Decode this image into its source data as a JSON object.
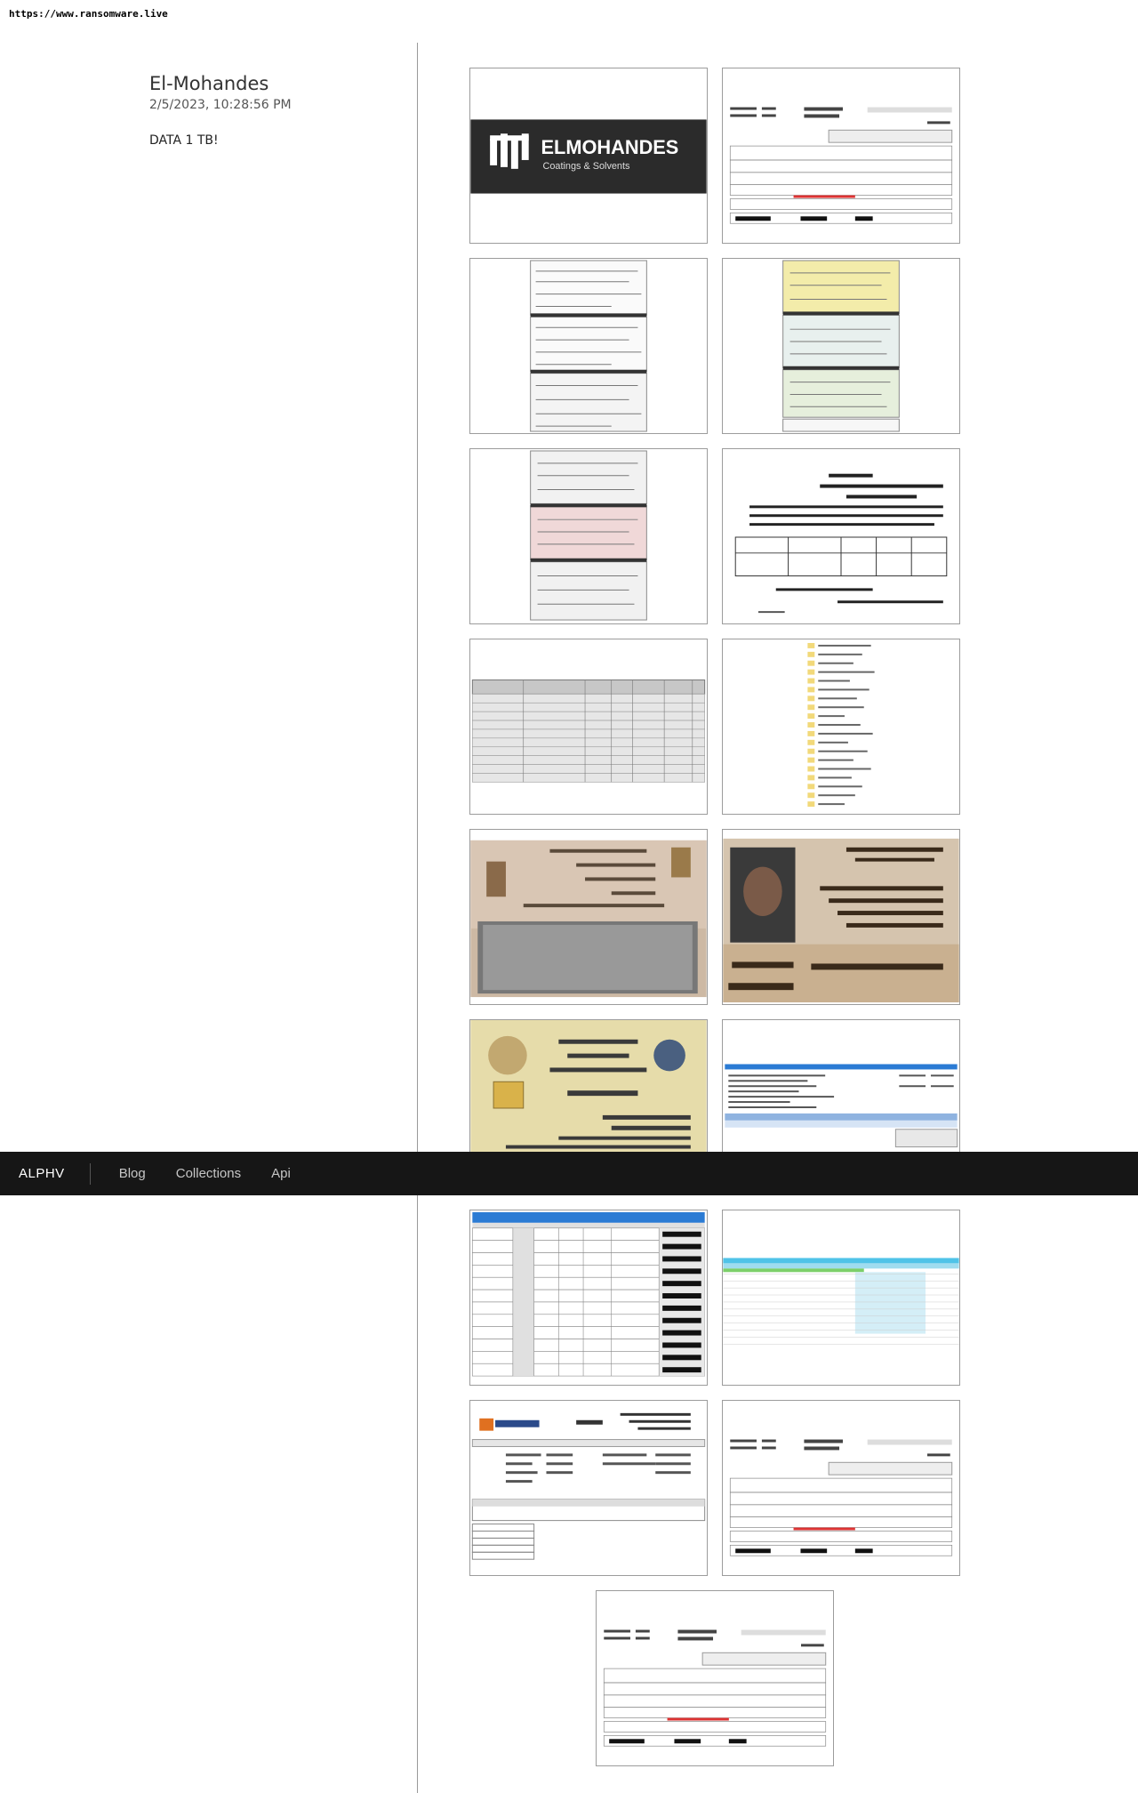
{
  "browser": {
    "url": "https://www.ransomware.live"
  },
  "post": {
    "title": "El-Mohandes",
    "date": "2/5/2023, 10:28:56 PM",
    "description": "DATA 1 TB!"
  },
  "navbar": {
    "brand": "ALPHV",
    "links": [
      "Blog",
      "Collections",
      "Api"
    ]
  },
  "gallery": {
    "logo": {
      "brand": "ELMOHANDES",
      "tagline": "Coatings & Solvents"
    },
    "thumbnails": [
      {
        "type": "logo"
      },
      {
        "type": "account-statement"
      },
      {
        "type": "cheque-scans"
      },
      {
        "type": "cheque-scans-color"
      },
      {
        "type": "cheque-scans-red"
      },
      {
        "type": "arabic-letter"
      },
      {
        "type": "arabic-table"
      },
      {
        "type": "folder-list"
      },
      {
        "type": "id-card-back"
      },
      {
        "type": "id-card-front"
      },
      {
        "type": "tax-card"
      },
      {
        "type": "invoice-blue"
      },
      {
        "type": "cheque-table"
      },
      {
        "type": "spreadsheet"
      },
      {
        "type": "invoice-elmohandes"
      },
      {
        "type": "account-statement"
      },
      {
        "type": "account-statement"
      }
    ]
  },
  "colors": {
    "navbar_bg": "#161616",
    "logo_bg": "#2b2b2b",
    "table_header_blue": "#2b7bd4",
    "spreadsheet_cyan": "#4fc3e8"
  }
}
